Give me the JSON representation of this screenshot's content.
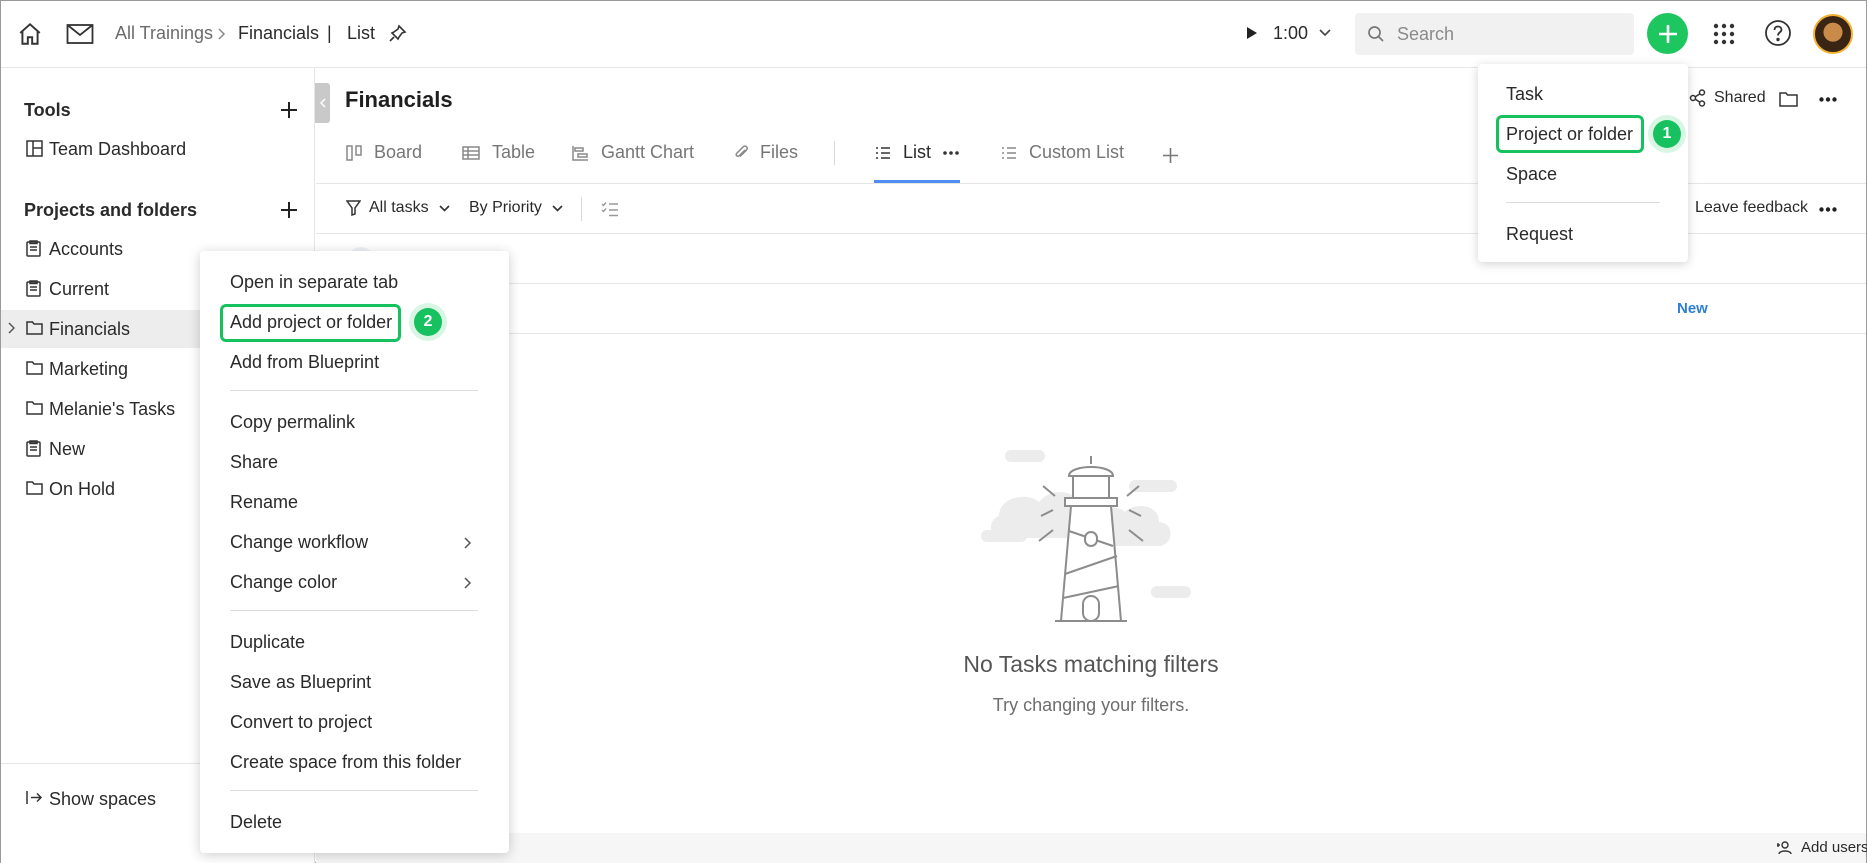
{
  "header": {
    "breadcrumb": [
      "All Trainings",
      "Financials",
      "List"
    ],
    "breadcrumb_separator": "|",
    "timer": "1:00",
    "search_placeholder": "Search"
  },
  "sidebar": {
    "tools_heading": "Tools",
    "tools_items": [
      "Team Dashboard"
    ],
    "projects_heading": "Projects and folders",
    "items": [
      {
        "label": "Accounts",
        "icon": "project-icon"
      },
      {
        "label": "Current",
        "icon": "project-icon"
      },
      {
        "label": "Financials",
        "icon": "folder-icon",
        "active": true
      },
      {
        "label": "Marketing",
        "icon": "folder-icon"
      },
      {
        "label": "Melanie's Tasks",
        "icon": "folder-icon"
      },
      {
        "label": "New",
        "icon": "project-icon"
      },
      {
        "label": "On Hold",
        "icon": "folder-icon"
      }
    ],
    "show_spaces": "Show spaces"
  },
  "main": {
    "title": "Financials",
    "shared_label": "Shared",
    "tabs": [
      {
        "label": "Board",
        "icon": "board-icon"
      },
      {
        "label": "Table",
        "icon": "table-icon"
      },
      {
        "label": "Gantt Chart",
        "icon": "gantt-icon"
      },
      {
        "label": "Files",
        "icon": "paperclip-icon"
      },
      {
        "label": "List",
        "icon": "list-icon",
        "active": true
      },
      {
        "label": "Custom List",
        "icon": "list-icon"
      }
    ],
    "filters": {
      "all_tasks": "All tasks",
      "by_priority": "By Priority",
      "leave_feedback": "Leave feedback"
    },
    "group_new": "New",
    "empty_title": "No Tasks matching filters",
    "empty_subtitle": "Try changing your filters.",
    "add_users": "Add users"
  },
  "plus_menu": {
    "items": [
      "Task",
      "Project or folder",
      "Space",
      "Request"
    ]
  },
  "context_menu": {
    "group1": [
      "Open in separate tab",
      "Add project or folder",
      "Add from Blueprint"
    ],
    "group2": [
      "Copy permalink",
      "Share",
      "Rename",
      "Change workflow",
      "Change color"
    ],
    "group3": [
      "Duplicate",
      "Save as Blueprint",
      "Convert to project",
      "Create space from this folder"
    ],
    "group4": [
      "Delete"
    ]
  },
  "callouts": {
    "step1": "1",
    "step2": "2"
  },
  "colors": {
    "accent_green": "#1ec65f",
    "tab_active_blue": "#4d8ef0",
    "link_blue": "#2d7fd6"
  }
}
